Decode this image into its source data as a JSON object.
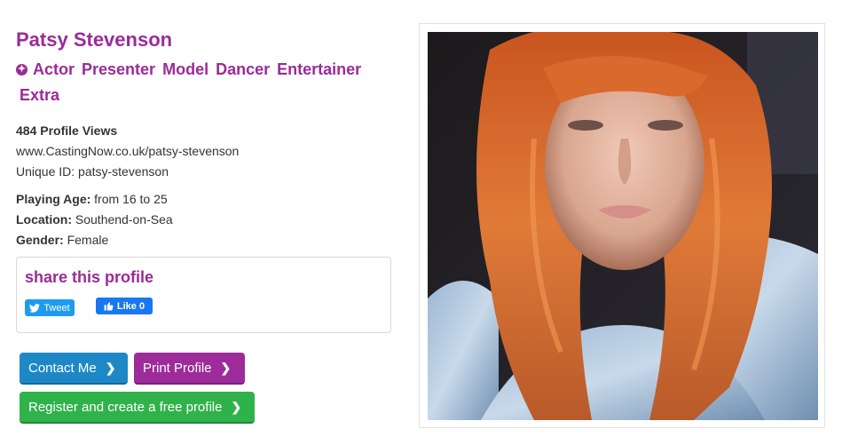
{
  "profile": {
    "name": "Patsy Stevenson",
    "roles": [
      "Actor",
      "Presenter",
      "Model",
      "Dancer",
      "Entertainer",
      "Extra"
    ],
    "views": "484 Profile Views",
    "url": "www.CastingNow.co.uk/patsy-stevenson",
    "unique_id": "Unique ID: patsy-stevenson",
    "playing_age_label": "Playing Age:",
    "playing_age_value": "from 16 to 25",
    "location_label": "Location:",
    "location_value": "Southend-on-Sea",
    "gender_label": "Gender:",
    "gender_value": "Female"
  },
  "share": {
    "title": "share this profile",
    "tweet_label": "Tweet",
    "like_label": "Like 0"
  },
  "buttons": {
    "contact": "Contact Me",
    "print": "Print Profile",
    "register": "Register and create a free profile"
  },
  "colors": {
    "brand_purple": "#9b2b98",
    "contact_blue": "#1e88c7",
    "register_green": "#30b24a"
  }
}
